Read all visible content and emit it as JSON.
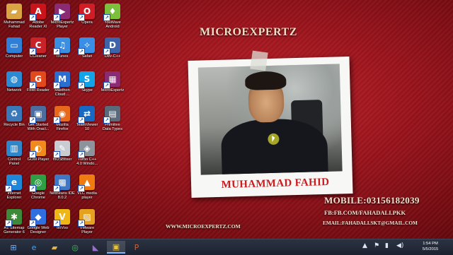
{
  "desktop": {
    "icons": [
      {
        "label": "Muhammad\nFahad",
        "name": "muhammad-fahad-folder",
        "glyph": "▰",
        "color": "#d9a441",
        "col": 0,
        "row": 0,
        "shortcut": false
      },
      {
        "label": "Adobe\nReader XI",
        "name": "adobe-reader-xi",
        "glyph": "A",
        "color": "#c8141a",
        "col": 1,
        "row": 0,
        "shortcut": true
      },
      {
        "label": "MicroExpertz\nPlayer",
        "name": "microexpertz-player",
        "glyph": "▶",
        "color": "#8a2b74",
        "col": 2,
        "row": 0,
        "shortcut": true
      },
      {
        "label": "Opera",
        "name": "opera",
        "glyph": "O",
        "color": "#d11d26",
        "col": 3,
        "row": 0,
        "shortcut": true
      },
      {
        "label": "YouWave\nAndroid",
        "name": "youwave-android",
        "glyph": "♦",
        "color": "#7cbf3c",
        "col": 4,
        "row": 0,
        "shortcut": true
      },
      {
        "label": "Computer",
        "name": "computer",
        "glyph": "▭",
        "color": "#2f7fd6",
        "col": 0,
        "row": 1,
        "shortcut": false
      },
      {
        "label": "CCleaner",
        "name": "ccleaner",
        "glyph": "C",
        "color": "#c9232a",
        "col": 1,
        "row": 1,
        "shortcut": true
      },
      {
        "label": "iTunes",
        "name": "itunes",
        "glyph": "♫",
        "color": "#3b8fe0",
        "col": 2,
        "row": 1,
        "shortcut": true
      },
      {
        "label": "Safari",
        "name": "safari",
        "glyph": "✧",
        "color": "#3a8ee6",
        "col": 3,
        "row": 1,
        "shortcut": true
      },
      {
        "label": "Dev-C++",
        "name": "dev-cpp",
        "glyph": "D",
        "color": "#3e63a8",
        "col": 4,
        "row": 1,
        "shortcut": true
      },
      {
        "label": "Network",
        "name": "network",
        "glyph": "◍",
        "color": "#2b8ad1",
        "col": 0,
        "row": 2,
        "shortcut": false
      },
      {
        "label": "Foxit Reader",
        "name": "foxit-reader",
        "glyph": "G",
        "color": "#e04a1d",
        "col": 1,
        "row": 2,
        "shortcut": true
      },
      {
        "label": "Maxthon\nCloud ...",
        "name": "maxthon-cloud",
        "glyph": "M",
        "color": "#2c6ecf",
        "col": 2,
        "row": 2,
        "shortcut": true
      },
      {
        "label": "Skype",
        "name": "skype",
        "glyph": "S",
        "color": "#13a4e8",
        "col": 3,
        "row": 2,
        "shortcut": true
      },
      {
        "label": "MicroExpertz",
        "name": "microexpertz",
        "glyph": "▦",
        "color": "#8a2b74",
        "col": 4,
        "row": 2,
        "shortcut": true
      },
      {
        "label": "Recycle Bin",
        "name": "recycle-bin",
        "glyph": "♻",
        "color": "#3a78b8",
        "col": 0,
        "row": 3,
        "shortcut": false
      },
      {
        "label": "Get Started\nWith Oracl...",
        "name": "get-started-oracle",
        "glyph": "▣",
        "color": "#4c6d9e",
        "col": 1,
        "row": 3,
        "shortcut": true
      },
      {
        "label": "Mozilla\nFirefox",
        "name": "mozilla-firefox",
        "glyph": "◉",
        "color": "#e8681c",
        "col": 2,
        "row": 3,
        "shortcut": true
      },
      {
        "label": "TeamViewer\n10",
        "name": "teamviewer-10",
        "glyph": "⇄",
        "color": "#1668c2",
        "col": 3,
        "row": 3,
        "shortcut": true
      },
      {
        "label": "Primitive\nData Types",
        "name": "primitive-data-types",
        "glyph": "▤",
        "color": "#5a6a7a",
        "col": 4,
        "row": 3,
        "shortcut": true
      },
      {
        "label": "Control\nPanel",
        "name": "control-panel",
        "glyph": "▥",
        "color": "#2f86c9",
        "col": 0,
        "row": 4,
        "shortcut": false
      },
      {
        "label": "GOM Player",
        "name": "gom-player",
        "glyph": "◐",
        "color": "#f08a1c",
        "col": 1,
        "row": 4,
        "shortcut": true
      },
      {
        "label": "mUSBfixer",
        "name": "musbfixer",
        "glyph": "✎",
        "color": "#c9cdd2",
        "col": 2,
        "row": 4,
        "shortcut": true
      },
      {
        "label": "Turbo C++\n4.0 Windo...",
        "name": "turbo-cpp",
        "glyph": "◈",
        "color": "#8d939b",
        "col": 3,
        "row": 4,
        "shortcut": true
      },
      {
        "label": "Internet\nExplorer",
        "name": "internet-explorer",
        "glyph": "e",
        "color": "#1f86d8",
        "col": 0,
        "row": 5,
        "shortcut": true
      },
      {
        "label": "Google\nChrome",
        "name": "google-chrome",
        "glyph": "◎",
        "color": "#2f9e44",
        "col": 1,
        "row": 5,
        "shortcut": true
      },
      {
        "label": "NetBeans IDE\n8.0.2",
        "name": "netbeans-ide",
        "glyph": "▩",
        "color": "#3f77c4",
        "col": 2,
        "row": 5,
        "shortcut": true
      },
      {
        "label": "VLC media\nplayer",
        "name": "vlc-media-player",
        "glyph": "▲",
        "color": "#f07b10",
        "col": 3,
        "row": 5,
        "shortcut": true
      },
      {
        "label": "A1 Sitemap\nGenerator 6",
        "name": "a1-sitemap-generator",
        "glyph": "✱",
        "color": "#3d8a3b",
        "col": 0,
        "row": 6,
        "shortcut": true
      },
      {
        "label": "Google Web\nDesigner",
        "name": "google-web-designer",
        "glyph": "◆",
        "color": "#2f6fe0",
        "col": 1,
        "row": 6,
        "shortcut": true
      },
      {
        "label": "ooVoo",
        "name": "oovoo",
        "glyph": "V",
        "color": "#f0b616",
        "col": 2,
        "row": 6,
        "shortcut": true
      },
      {
        "label": "VMware\nPlayer",
        "name": "vmware-player",
        "glyph": "▧",
        "color": "#e6a11e",
        "col": 3,
        "row": 6,
        "shortcut": true
      }
    ]
  },
  "wallpaper": {
    "title": "MICROEXPERTZ",
    "name": "MUHAMMAD FAHID",
    "mobile": "MOBILE:03156182039",
    "fb": "FB:FB.COM/FAHADALI.PKK",
    "email": "EMAIL:FAHADALI.SKT@GMAIL.COM",
    "website": "WWW.MICROEXPERTZ.COM"
  },
  "taskbar": {
    "buttons": [
      {
        "name": "start-button",
        "glyph": "⊞",
        "color": "#6ab0ff",
        "active": false
      },
      {
        "name": "internet-explorer-taskbar",
        "glyph": "e",
        "color": "#4aa3ef",
        "active": false
      },
      {
        "name": "file-explorer-taskbar",
        "glyph": "▰",
        "color": "#e0b24a",
        "active": false
      },
      {
        "name": "chrome-taskbar",
        "glyph": "◎",
        "color": "#4cc062",
        "active": false
      },
      {
        "name": "visual-studio-taskbar",
        "glyph": "◣",
        "color": "#9b6bd6",
        "active": false
      },
      {
        "name": "recorder-taskbar",
        "glyph": "▣",
        "color": "#e8c23a",
        "active": true
      },
      {
        "name": "powerpoint-taskbar",
        "glyph": "P",
        "color": "#e05a2a",
        "active": false
      }
    ],
    "clock": {
      "time": "1:54 PM",
      "date": "5/5/2015"
    }
  }
}
